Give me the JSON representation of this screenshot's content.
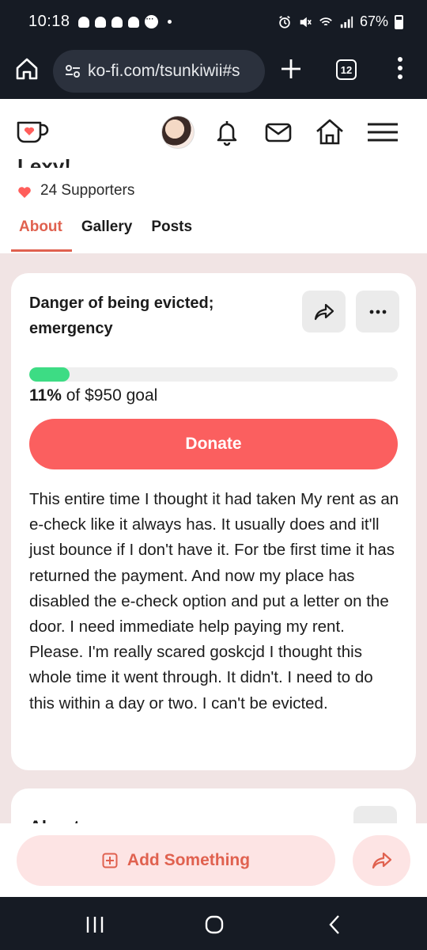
{
  "status_bar": {
    "time": "10:18",
    "battery": "67%",
    "notification_icons": [
      "snapchat-icon",
      "snapchat-icon",
      "snapchat-icon",
      "snapchat-icon",
      "chat-bubble-icon"
    ],
    "system_icons": [
      "alarm-icon",
      "mute-icon",
      "wifi-icon",
      "signal-icon",
      "battery-icon"
    ]
  },
  "browser": {
    "url": "ko-fi.com/tsunkiwii#s",
    "tab_count": "12"
  },
  "header": {
    "icons": [
      "kofi-logo",
      "avatar",
      "bell-icon",
      "mail-icon",
      "home-icon",
      "hamburger-menu-icon"
    ]
  },
  "profile": {
    "partial_name": "Lexy!",
    "supporters": "24 Supporters"
  },
  "nav": {
    "tabs": [
      {
        "label": "About",
        "active": true
      },
      {
        "label": "Gallery",
        "active": false
      },
      {
        "label": "Posts",
        "active": false
      }
    ]
  },
  "goal": {
    "title": "Danger of being evicted; emergency",
    "progress_fraction": 0.11,
    "percent": "11%",
    "goal_text": "of $950 goal",
    "donate_label": "Donate",
    "description": "This entire time I thought it had taken My rent as an e-check like it always has. It usually does and it'll just bounce if I don't have it. For tbe first time it has returned the payment. And now my place has disabled the e-check option and put a letter on the door. I need immediate help paying my rent. Please. I'm really scared goskcjd I thought this whole time it went through. It didn't. I need to do this within a day or two. I can't be evicted."
  },
  "about_card": {
    "partial_title": "About"
  },
  "bottom_bar": {
    "add_label": "Add Something"
  },
  "colors": {
    "accent": "#e0614f",
    "donate": "#fb5f5f",
    "progress": "#3ddc84",
    "page_bg": "#f1e4e4",
    "system_bar": "#161b24"
  }
}
